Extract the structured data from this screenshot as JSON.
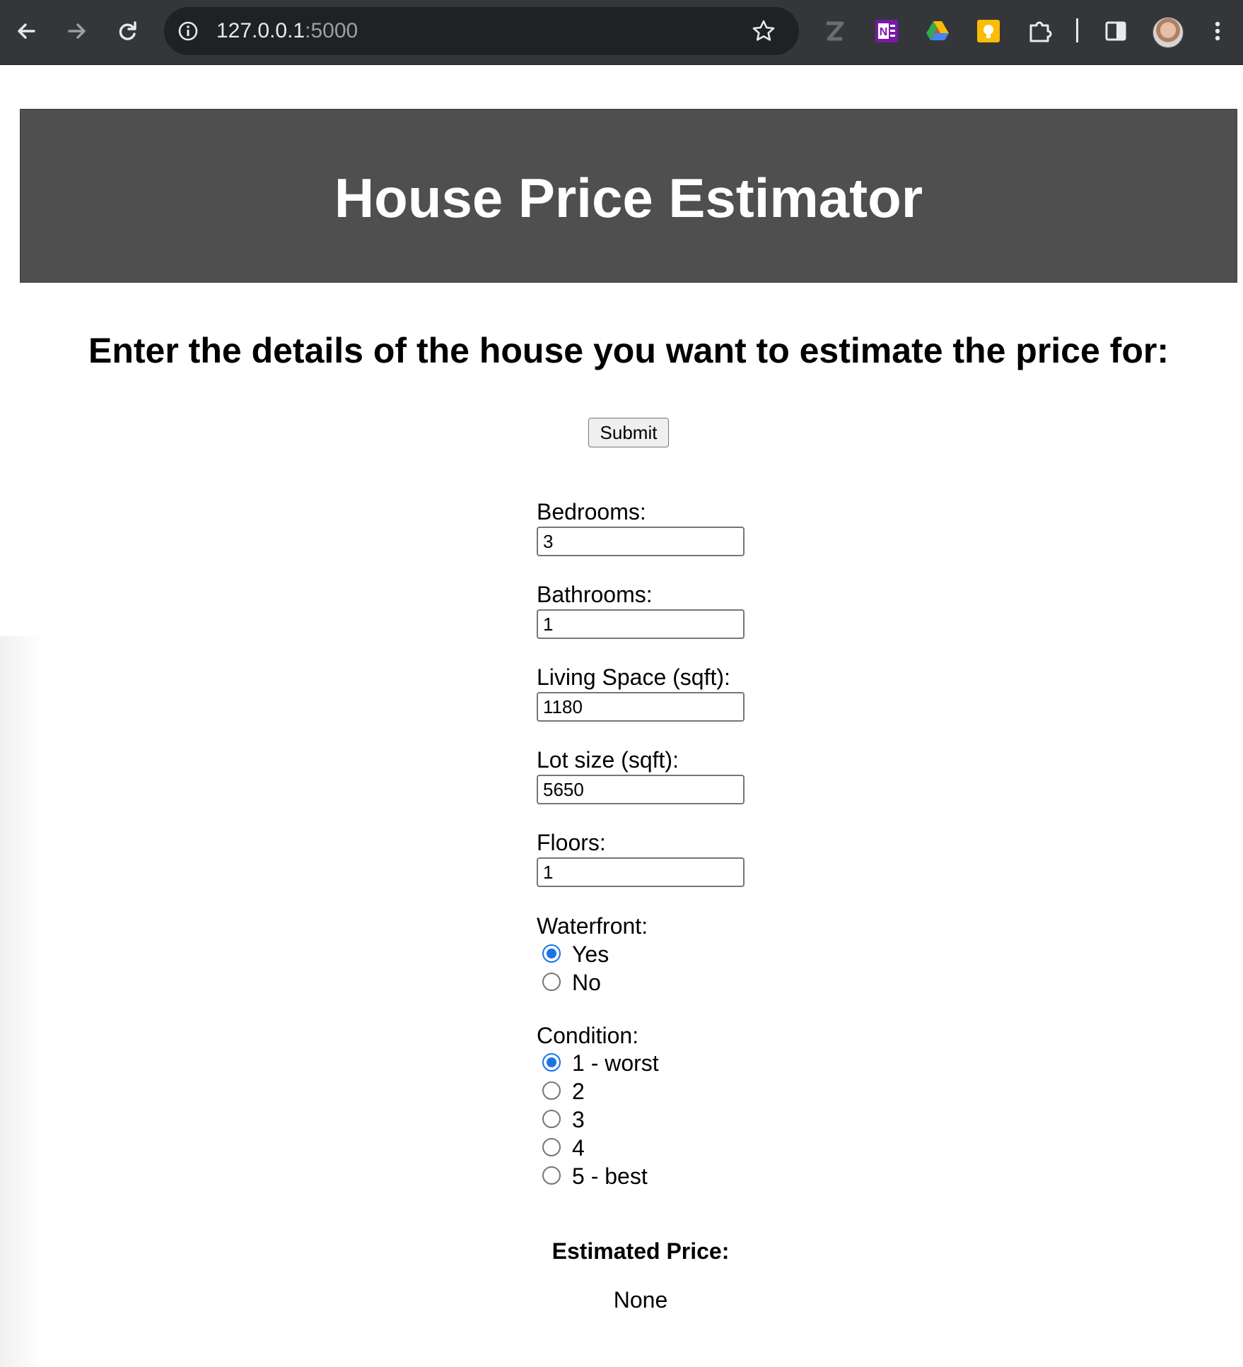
{
  "browser": {
    "url_host": "127.0.0.1",
    "url_port": ":5000",
    "icons": {
      "back": "arrow-left-icon",
      "forward": "arrow-right-icon",
      "reload": "reload-icon",
      "site_info": "info-icon",
      "bookmark": "star-icon",
      "extensions": [
        "zotero-icon",
        "onenote-icon",
        "google-drive-icon",
        "google-keep-icon",
        "puzzle-extensions-icon"
      ],
      "side_panel": "side-panel-icon",
      "profile": "avatar",
      "menu": "kebab-menu-icon"
    },
    "onenote_letter": "N"
  },
  "header": {
    "title": "House Price Estimator",
    "background": "#4f4f4f"
  },
  "form": {
    "intro": "Enter the details of the house you want to estimate the price for:",
    "submit_label": "Submit",
    "fields": [
      {
        "label": "Bedrooms:",
        "value": "3"
      },
      {
        "label": "Bathrooms:",
        "value": "1"
      },
      {
        "label": "Living Space (sqft):",
        "value": "1180"
      },
      {
        "label": "Lot size (sqft):",
        "value": "5650"
      },
      {
        "label": "Floors:",
        "value": "1"
      }
    ],
    "waterfront": {
      "label": "Waterfront:",
      "options": [
        {
          "label": "Yes",
          "checked": true
        },
        {
          "label": "No",
          "checked": false
        }
      ]
    },
    "condition": {
      "label": "Condition:",
      "options": [
        {
          "label": "1 - worst",
          "checked": true
        },
        {
          "label": "2",
          "checked": false
        },
        {
          "label": "3",
          "checked": false
        },
        {
          "label": "4",
          "checked": false
        },
        {
          "label": "5 - best",
          "checked": false
        }
      ]
    }
  },
  "result": {
    "title": "Estimated Price:",
    "value": "None"
  },
  "colors": {
    "radio_checked": "#1a73e8",
    "chrome_bar": "#35363a"
  }
}
